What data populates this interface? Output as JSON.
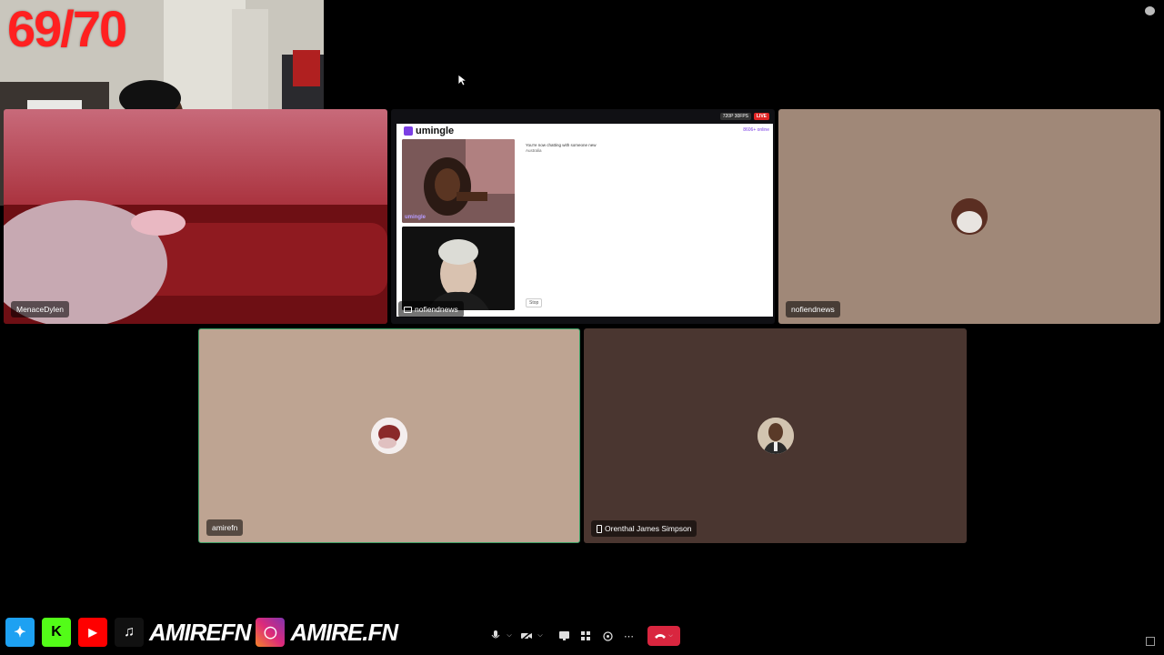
{
  "overlay": {
    "counter": "69/70"
  },
  "participants": [
    {
      "name": "MenaceDylen"
    },
    {
      "name": "nofiendnews"
    },
    {
      "name": "nofiendnews"
    },
    {
      "name": "amirefn"
    },
    {
      "name": "Orenthal James Simpson"
    }
  ],
  "shared_screen": {
    "stream_badge": "720P 30FPS",
    "live_badge": "LIVE",
    "site_name": "umingle",
    "online_count": "8606+ online",
    "status_line": "You're now chatting with someone new",
    "location": "Australia",
    "remote_label": "umingle",
    "stop_label": "Stop"
  },
  "social": {
    "handle1": "AMIREFN",
    "handle2": "AMIRE.FN"
  },
  "colors": {
    "accent_purple": "#7b3fe4",
    "end_call": "#d9263f",
    "live_red": "#e02424"
  }
}
